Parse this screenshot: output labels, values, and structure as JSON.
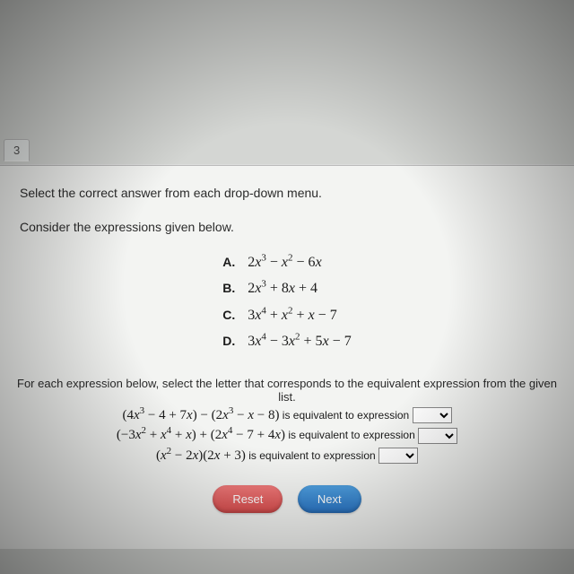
{
  "tab": {
    "label": "3"
  },
  "instruction": "Select the correct answer from each drop-down menu.",
  "consider": "Consider the expressions given below.",
  "options": {
    "A": {
      "label": "A.",
      "expr": "2x³ − x² − 6x"
    },
    "B": {
      "label": "B.",
      "expr": "2x³ + 8x + 4"
    },
    "C": {
      "label": "C.",
      "expr": "3x⁴ + x² + x − 7"
    },
    "D": {
      "label": "D.",
      "expr": "3x⁴ − 3x² + 5x − 7"
    }
  },
  "prompt2": "For each expression below, select the letter that corresponds to the equivalent expression from the given list.",
  "rows": {
    "r1": {
      "expr": "(4x³ − 4 + 7x) − (2x³ − x − 8)",
      "trail": " is equivalent to expression "
    },
    "r2": {
      "expr": "(−3x² + x⁴ + x) + (2x⁴ − 7 + 4x)",
      "trail": " is equivalent to expression "
    },
    "r3": {
      "expr": "(x² − 2x)(2x + 3)",
      "trail": " is equivalent to expression "
    }
  },
  "buttons": {
    "reset": "Reset",
    "next": "Next"
  }
}
